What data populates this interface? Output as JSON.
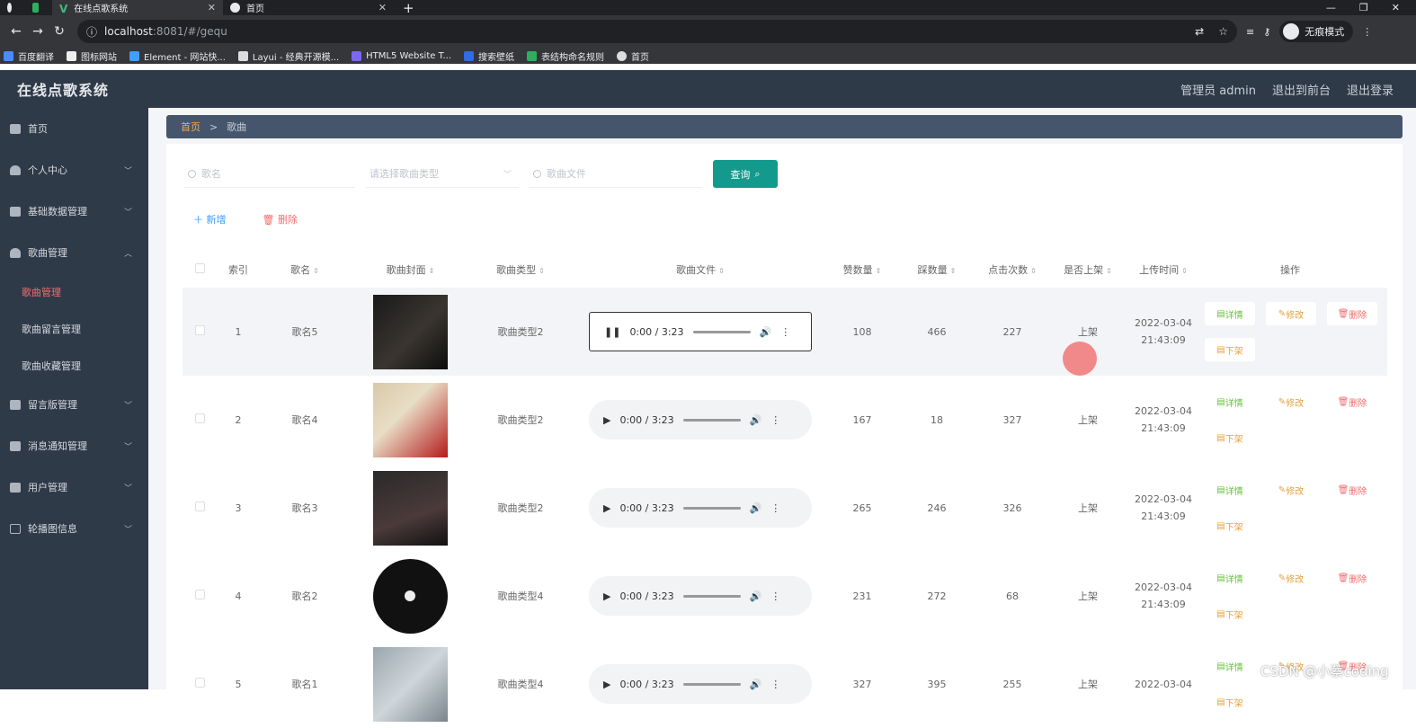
{
  "browser": {
    "tabs": [
      {
        "label": ""
      },
      {
        "label": "在线点歌系统",
        "close": "✕"
      },
      {
        "label": "首页",
        "close": "✕"
      }
    ],
    "new_tab": "+",
    "url_host": "localhost",
    "url_path": ":8081/#/gequ",
    "incognito_label": "无痕模式",
    "bookmarks": [
      "百度翻译",
      "图标网站",
      "Element - 网站快...",
      "Layui - 经典开源模...",
      "HTML5 Website T...",
      "搜索壁纸",
      "表结构命名规则",
      "首页"
    ]
  },
  "header": {
    "title": "在线点歌系统",
    "admin": "管理员 admin",
    "to_front": "退出到前台",
    "logout": "退出登录"
  },
  "sidebar": {
    "items": [
      {
        "label": "首页"
      },
      {
        "label": "个人中心"
      },
      {
        "label": "基础数据管理"
      },
      {
        "label": "歌曲管理"
      },
      {
        "label": "歌曲管理"
      },
      {
        "label": "歌曲留言管理"
      },
      {
        "label": "歌曲收藏管理"
      },
      {
        "label": "留言版管理"
      },
      {
        "label": "消息通知管理"
      },
      {
        "label": "用户管理"
      },
      {
        "label": "轮播图信息"
      }
    ]
  },
  "breadcrumb": {
    "home": "首页",
    "sep": ">",
    "current": "歌曲"
  },
  "search": {
    "name_placeholder": "歌名",
    "type_placeholder": "请选择歌曲类型",
    "file_placeholder": "歌曲文件",
    "query": "查询"
  },
  "actions": {
    "add": "＋ 新增",
    "delete": "删除"
  },
  "table": {
    "headers": [
      "索引",
      "歌名",
      "歌曲封面",
      "歌曲类型",
      "歌曲文件",
      "赞数量",
      "踩数量",
      "点击次数",
      "是否上架",
      "上传时间",
      "操作"
    ],
    "rows": [
      {
        "index": "1",
        "name": "歌名5",
        "type": "歌曲类型2",
        "time_a": "0:00 / 3:23",
        "like": "108",
        "dislike": "466",
        "clicks": "227",
        "shelf": "上架",
        "date": "2022-03-04",
        "clock": "21:43:09"
      },
      {
        "index": "2",
        "name": "歌名4",
        "type": "歌曲类型2",
        "time_a": "0:00 / 3:23",
        "like": "167",
        "dislike": "18",
        "clicks": "327",
        "shelf": "上架",
        "date": "2022-03-04",
        "clock": "21:43:09"
      },
      {
        "index": "3",
        "name": "歌名3",
        "type": "歌曲类型2",
        "time_a": "0:00 / 3:23",
        "like": "265",
        "dislike": "246",
        "clicks": "326",
        "shelf": "上架",
        "date": "2022-03-04",
        "clock": "21:43:09"
      },
      {
        "index": "4",
        "name": "歌名2",
        "type": "歌曲类型4",
        "time_a": "0:00 / 3:23",
        "like": "231",
        "dislike": "272",
        "clicks": "68",
        "shelf": "上架",
        "date": "2022-03-04",
        "clock": "21:43:09"
      },
      {
        "index": "5",
        "name": "歌名1",
        "type": "歌曲类型4",
        "time_a": "0:00 / 3:23",
        "like": "327",
        "dislike": "395",
        "clicks": "255",
        "shelf": "上架",
        "date": "2022-03-04",
        "clock": ""
      }
    ],
    "op_detail": "详情",
    "op_edit": "修改",
    "op_delete": "删除",
    "op_off": "下架"
  },
  "watermark": "CSDN @小蔡coding"
}
